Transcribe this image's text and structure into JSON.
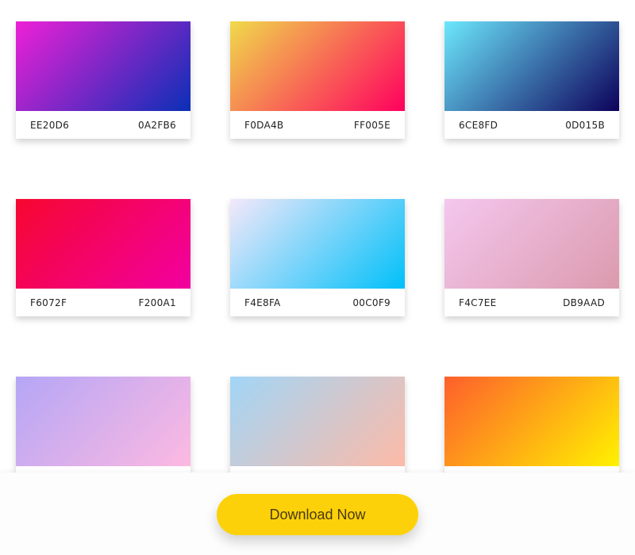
{
  "gradients": [
    {
      "from_label": "EE20D6",
      "to_label": "0A2FB6",
      "from": "#EE20D6",
      "to": "#0A2FB6"
    },
    {
      "from_label": "F0DA4B",
      "to_label": "FF005E",
      "from": "#F0DA4B",
      "to": "#FF005E"
    },
    {
      "from_label": "6CE8FD",
      "to_label": "0D015B",
      "from": "#6CE8FD",
      "to": "#0D015B"
    },
    {
      "from_label": "F6072F",
      "to_label": "F200A1",
      "from": "#F6072F",
      "to": "#F200A1"
    },
    {
      "from_label": "F4E8FA",
      "to_label": "00C0F9",
      "from": "#F4E8FA",
      "to": "#00C0F9"
    },
    {
      "from_label": "F4C7EE",
      "to_label": "DB9AAD",
      "from": "#F4C7EE",
      "to": "#DB9AAD"
    },
    {
      "from_label": "",
      "to_label": "",
      "from": "#B5A6F6",
      "to": "#FDB9E1"
    },
    {
      "from_label": "",
      "to_label": "",
      "from": "#A2D6F7",
      "to": "#FDBAA7"
    },
    {
      "from_label": "",
      "to_label": "",
      "from": "#FE5F2C",
      "to": "#FFF200"
    }
  ],
  "footer": {
    "download_label": "Download Now",
    "button_color": "#FCD10A"
  }
}
